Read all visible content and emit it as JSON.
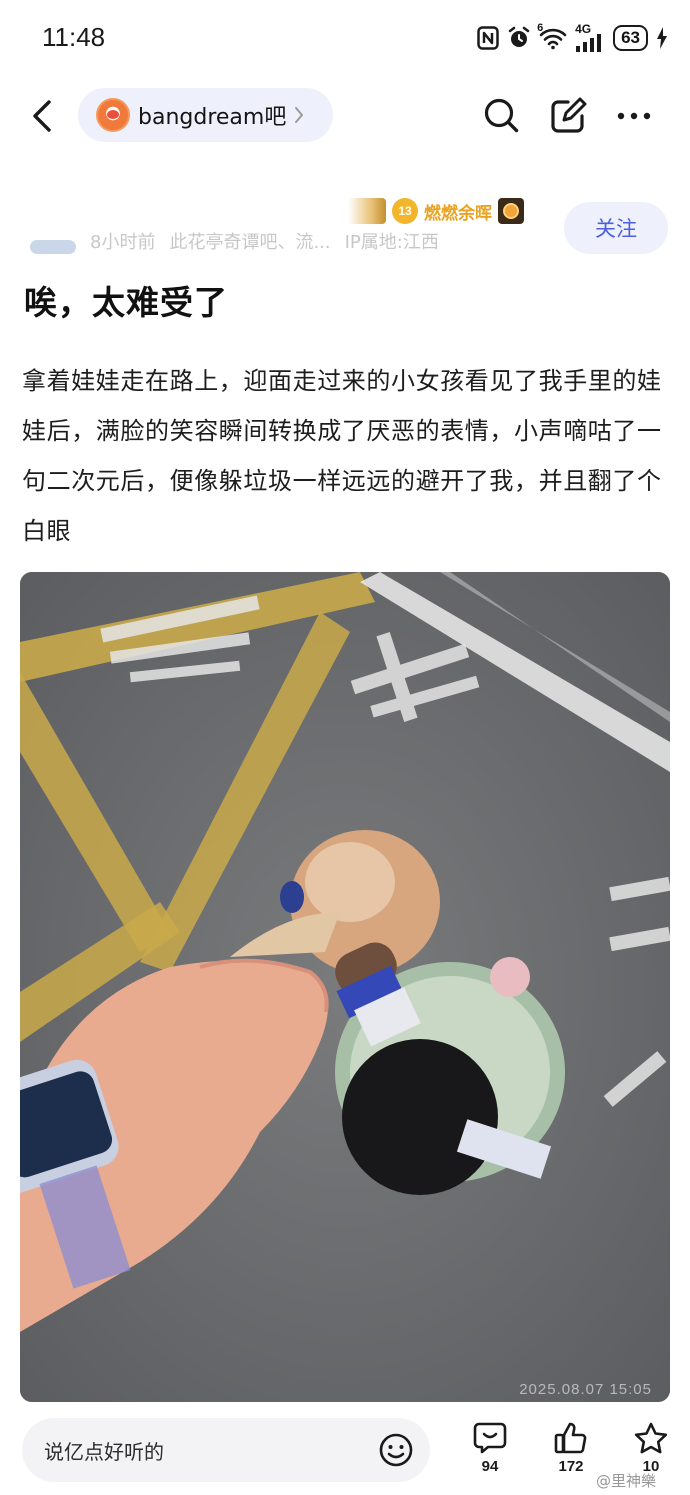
{
  "status_bar": {
    "time": "11:48",
    "network": "4G",
    "signal_badge": "6",
    "battery": "63",
    "icons": [
      "nfc-icon",
      "alarm-icon",
      "wifi-icon",
      "cellular-signal-icon",
      "battery-icon",
      "charging-icon"
    ]
  },
  "nav": {
    "forum_name": "bangdream吧",
    "icons": [
      "back-icon",
      "search-icon",
      "edit-icon",
      "more-icon"
    ]
  },
  "author": {
    "level": "13",
    "title": "燃燃余晖",
    "meta": [
      "8小时前",
      "此花亭奇谭吧、流...",
      "IP属地:江西"
    ],
    "follow_label": "关注"
  },
  "post": {
    "title": "唉，太难受了",
    "body": "拿着娃娃走在路上，迎面走过来的小女孩看见了我手里的娃娃后，满脸的笑容瞬间转换成了厌恶的表情，小声嘀咕了一句二次元后，便像躲垃圾一样远远的避开了我，并且翻了个白眼",
    "photo_timestamp": "2025.08.07 15:05"
  },
  "bottom_bar": {
    "comment_placeholder": "说亿点好听的",
    "comment_count": "94",
    "like_count": "172",
    "favorite_count": "10",
    "watermark": "@里神樂"
  },
  "colors": {
    "accent": "#4d5fe0",
    "pill_bg": "#eef0fb",
    "title_gold": "#e9a323"
  }
}
